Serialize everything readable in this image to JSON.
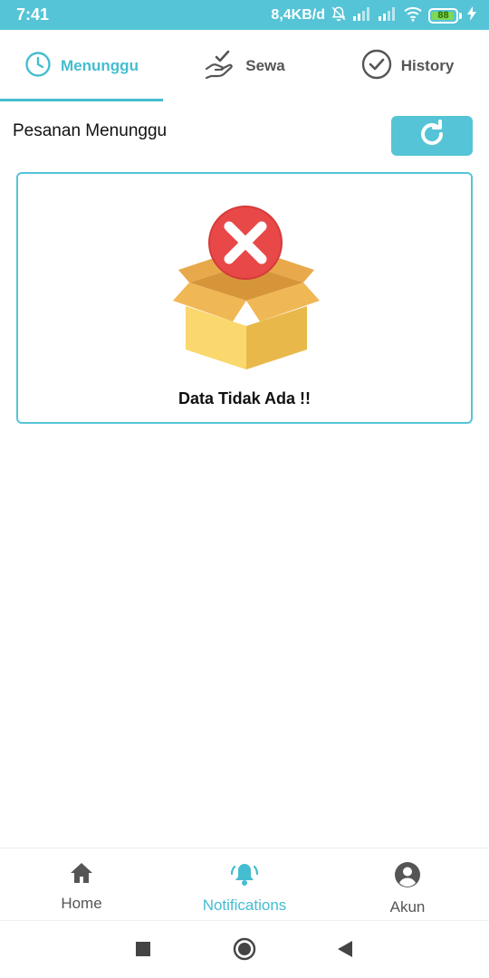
{
  "status_bar": {
    "time": "7:41",
    "net_speed": "8,4KB/d",
    "battery_level": "88"
  },
  "tabs": [
    {
      "label": "Menunggu",
      "icon": "clock-icon",
      "active": true
    },
    {
      "label": "Sewa",
      "icon": "hand-check-icon",
      "active": false
    },
    {
      "label": "History",
      "icon": "check-circle-icon",
      "active": false
    }
  ],
  "section": {
    "title": "Pesanan Menunggu"
  },
  "empty_state": {
    "message": "Data Tidak Ada !!",
    "icon": "empty-box-icon"
  },
  "bottom_nav": [
    {
      "label": "Home",
      "icon": "home-icon",
      "active": false
    },
    {
      "label": "Notifications",
      "icon": "bell-icon",
      "active": true
    },
    {
      "label": "Akun",
      "icon": "account-icon",
      "active": false
    }
  ],
  "colors": {
    "accent": "#55c4d6",
    "active_text": "#45bdd0",
    "inactive_text": "#555555"
  }
}
